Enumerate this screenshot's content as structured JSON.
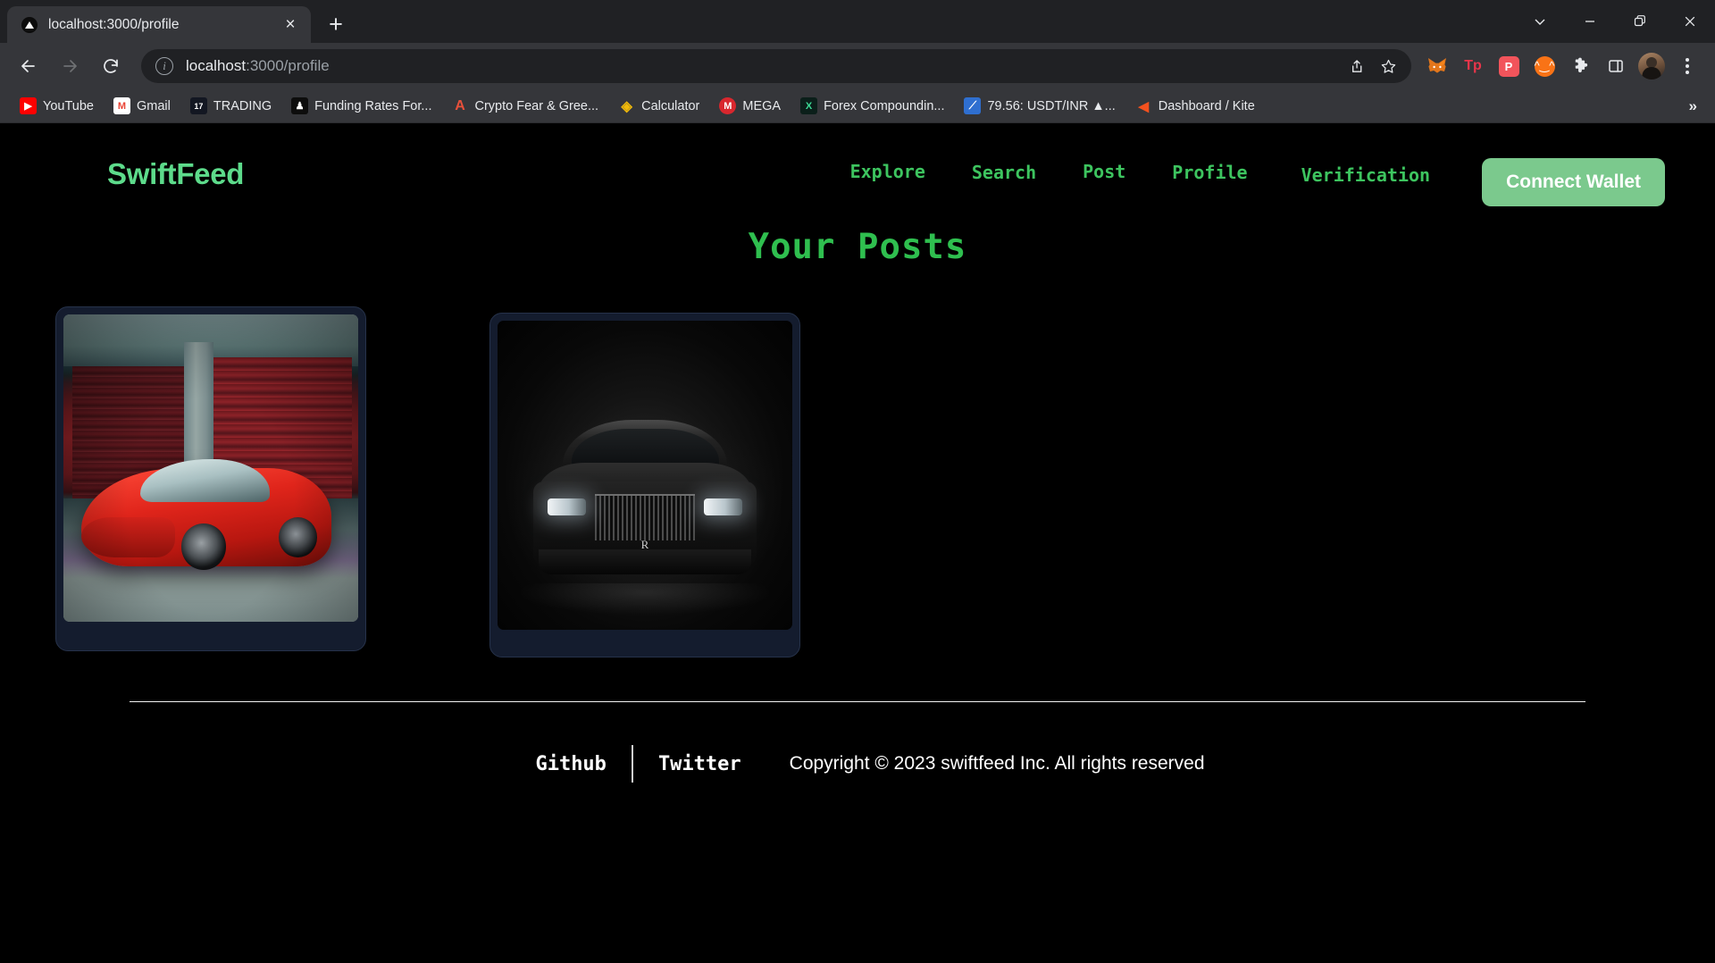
{
  "browser": {
    "tab": {
      "title": "localhost:3000/profile",
      "favicon": "triangle-play-icon",
      "close_label": "×"
    },
    "new_tab_label": "+",
    "window_controls": [
      {
        "name": "tab-search",
        "glyph": "⌄"
      },
      {
        "name": "minimize",
        "glyph": "—"
      },
      {
        "name": "restore",
        "glyph": "❐"
      },
      {
        "name": "close",
        "glyph": "✕"
      }
    ],
    "nav": {
      "back": "←",
      "forward": "→",
      "reload": "↻"
    },
    "omnibox": {
      "info_glyph": "i",
      "host": "localhost",
      "path": ":3000/profile",
      "share_glyph": "⤴",
      "star_glyph": "☆"
    },
    "extensions": [
      {
        "name": "metamask-icon",
        "label": "🦊",
        "bg": "#f5a623"
      },
      {
        "name": "tp-extension-icon",
        "label": "Tp",
        "bg": "#2b2b2b",
        "fg": "#e8354a"
      },
      {
        "name": "pocket-extension-icon",
        "label": "P",
        "bg": "#ef5350"
      },
      {
        "name": "emoji-extension-icon",
        "label": "◕",
        "bg": "#f97316"
      },
      {
        "name": "puzzle-extensions-icon",
        "label": "❖",
        "bg": "transparent"
      },
      {
        "name": "side-panel-icon",
        "label": "□",
        "bg": "transparent"
      }
    ],
    "profile_avatar": "user-avatar",
    "menu": "three-dot-menu",
    "bookmarks": [
      {
        "label": "YouTube",
        "icon": "youtube-icon",
        "bg": "#ff0000",
        "glyph": "▶",
        "fg": "#ffffff"
      },
      {
        "label": "Gmail",
        "icon": "gmail-icon",
        "bg": "#ffffff",
        "glyph": "M",
        "fg": "#ea4335"
      },
      {
        "label": "TRADING",
        "icon": "tradingview-icon",
        "bg": "#131722",
        "glyph": "17",
        "fg": "#ffffff"
      },
      {
        "label": "Funding Rates For...",
        "icon": "funding-rates-icon",
        "bg": "#0d0d0d",
        "glyph": "♟",
        "fg": "#ffffff"
      },
      {
        "label": "Crypto Fear & Gree...",
        "icon": "crypto-fear-greed-icon",
        "bg": "transparent",
        "glyph": "A",
        "fg": "#e8503a"
      },
      {
        "label": "Calculator",
        "icon": "binance-calculator-icon",
        "bg": "transparent",
        "glyph": "◈",
        "fg": "#f0b90b"
      },
      {
        "label": "MEGA",
        "icon": "mega-icon",
        "bg": "#d9272e",
        "glyph": "M",
        "fg": "#ffffff"
      },
      {
        "label": "Forex Compoundin...",
        "icon": "forex-compounding-icon",
        "bg": "#0b1f1a",
        "glyph": "X",
        "fg": "#3ddc97"
      },
      {
        "label": "79.56: USDT/INR ▲...",
        "icon": "usdt-inr-chart-icon",
        "bg": "#2f6fd0",
        "glyph": "⟋",
        "fg": "#ffffff"
      },
      {
        "label": "Dashboard / Kite",
        "icon": "kite-icon",
        "bg": "transparent",
        "glyph": "◀",
        "fg": "#f4511e"
      }
    ],
    "bookmarks_overflow": "»"
  },
  "site": {
    "logo": "SwiftFeed",
    "nav": [
      {
        "label": "Explore",
        "name": "nav-explore"
      },
      {
        "label": "Search",
        "name": "nav-search"
      },
      {
        "label": "Post",
        "name": "nav-post"
      },
      {
        "label": "Profile",
        "name": "nav-profile"
      },
      {
        "label": "Verification",
        "name": "nav-verification"
      }
    ],
    "connect_wallet": "Connect Wallet",
    "page_title": "Your Posts",
    "posts": [
      {
        "name": "post-card-ferrari",
        "alt": "red-ferrari-sports-car-in-front-of-red-garage-door"
      },
      {
        "name": "post-card-rolls-royce",
        "alt": "black-rolls-royce-front-view-with-headlights-on"
      }
    ],
    "footer": {
      "links": [
        {
          "label": "Github",
          "name": "footer-link-github"
        },
        {
          "label": "Twitter",
          "name": "footer-link-twitter"
        }
      ],
      "copyright": "Copyright © 2023 swiftfeed Inc. All rights reserved"
    }
  },
  "colors": {
    "brand_green": "#3dc45f",
    "logo_green": "#5ddb8b",
    "button_green": "#7bc98d",
    "page_bg": "#000000",
    "card_bg": "#141c2e",
    "card_border": "#26324a"
  }
}
